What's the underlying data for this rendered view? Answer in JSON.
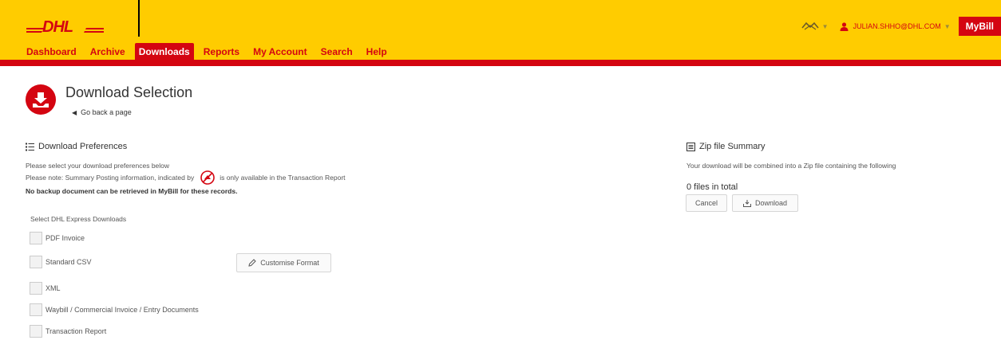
{
  "header": {
    "nav": [
      {
        "label": "Dashboard",
        "active": false
      },
      {
        "label": "Archive",
        "active": false
      },
      {
        "label": "Downloads",
        "active": true
      },
      {
        "label": "Reports",
        "active": false
      },
      {
        "label": "My Account",
        "active": false
      },
      {
        "label": "Search",
        "active": false
      },
      {
        "label": "Help",
        "active": false
      }
    ],
    "user_email": "JULIAN.SHHO@DHL.COM",
    "app_badge": "MyBill",
    "logo_icon": "dhl-logo",
    "colors": {
      "brand_yellow": "#ffcc00",
      "brand_red": "#d40511"
    }
  },
  "page": {
    "title": "Download Selection",
    "back_link": "Go back a page"
  },
  "preferences": {
    "heading": "Download Preferences",
    "line1": "Please select your download preferences below",
    "line2_before": "Please note: Summary Posting information, indicated by",
    "line2_after": "is only available in the Transaction Report",
    "line3": "No backup document can be retrieved in MyBill for these records.",
    "select_label": "Select DHL Express Downloads",
    "options": [
      {
        "label": "PDF Invoice",
        "checked": false
      },
      {
        "label": "Standard CSV",
        "checked": false
      },
      {
        "label": "XML",
        "checked": false
      },
      {
        "label": "Waybill / Commercial Invoice / Entry Documents",
        "checked": false
      },
      {
        "label": "Transaction Report",
        "checked": false
      }
    ],
    "customise_button": "Customise Format"
  },
  "zip": {
    "heading": "Zip file Summary",
    "description": "Your download will be combined into a Zip file containing the following",
    "files_total": "0 files in total",
    "cancel_button": "Cancel",
    "download_button": "Download"
  }
}
